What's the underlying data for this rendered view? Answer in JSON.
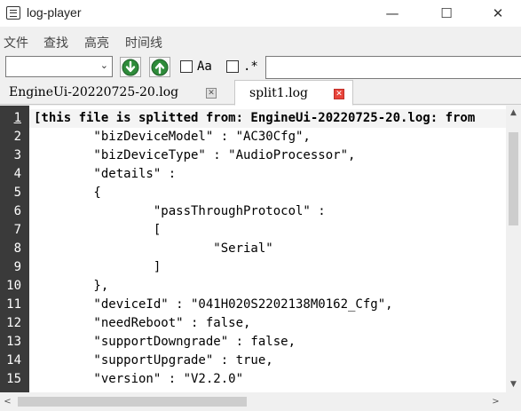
{
  "window": {
    "title": "log-player",
    "minimize_glyph": "—",
    "maximize_glyph": "☐",
    "close_glyph": "✕"
  },
  "menu": {
    "file": "文件",
    "search": "查找",
    "highlight": "高亮",
    "timeline": "时间线"
  },
  "toolbar": {
    "combo_value": "",
    "combo_arrow": "⌄",
    "next_icon": "arrow-down-circle-icon",
    "prev_icon": "arrow-up-circle-icon",
    "case_label": "Aa",
    "regex_label": ".*",
    "accent_green": "#2e8b3a"
  },
  "tabs": [
    {
      "label": "EngineUi-20220725-20.log",
      "close": "✕",
      "active": false
    },
    {
      "label": "split1.log",
      "close": "✕",
      "active": true
    }
  ],
  "editor": {
    "current_line": 1,
    "lines": [
      {
        "n": "1",
        "text": "[this file is splitted from: EngineUi-20220725-20.log: from"
      },
      {
        "n": "2",
        "text": "        \"bizDeviceModel\" : \"AC30Cfg\","
      },
      {
        "n": "3",
        "text": "        \"bizDeviceType\" : \"AudioProcessor\","
      },
      {
        "n": "4",
        "text": "        \"details\" :"
      },
      {
        "n": "5",
        "text": "        {"
      },
      {
        "n": "6",
        "text": "                \"passThroughProtocol\" :"
      },
      {
        "n": "7",
        "text": "                ["
      },
      {
        "n": "8",
        "text": "                        \"Serial\""
      },
      {
        "n": "9",
        "text": "                ]"
      },
      {
        "n": "10",
        "text": "        },"
      },
      {
        "n": "11",
        "text": "        \"deviceId\" : \"041H020S2202138M0162_Cfg\","
      },
      {
        "n": "12",
        "text": "        \"needReboot\" : false,"
      },
      {
        "n": "13",
        "text": "        \"supportDowngrade\" : false,"
      },
      {
        "n": "14",
        "text": "        \"supportUpgrade\" : true,"
      },
      {
        "n": "15",
        "text": "        \"version\" : \"V2.2.0\""
      }
    ]
  },
  "scroll": {
    "up_glyph": "▲",
    "down_glyph": "▼",
    "left_glyph": "<",
    "right_glyph": ">"
  }
}
